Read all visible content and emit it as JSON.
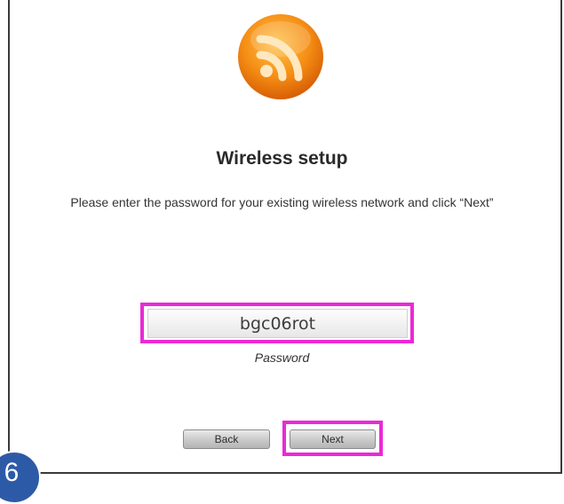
{
  "header": {
    "logo_icon": "rss-wifi-icon",
    "title": "Wireless setup"
  },
  "instruction": "Please enter the password for your existing wireless network and click “Next”",
  "password": {
    "value": "bgc06rot",
    "label": "Password"
  },
  "buttons": {
    "back": "Back",
    "next": "Next"
  },
  "step_badge": "6",
  "colors": {
    "highlight": "#ea2ad6",
    "logo_orange": "#f28a12",
    "badge_blue": "#2d5aa7"
  }
}
